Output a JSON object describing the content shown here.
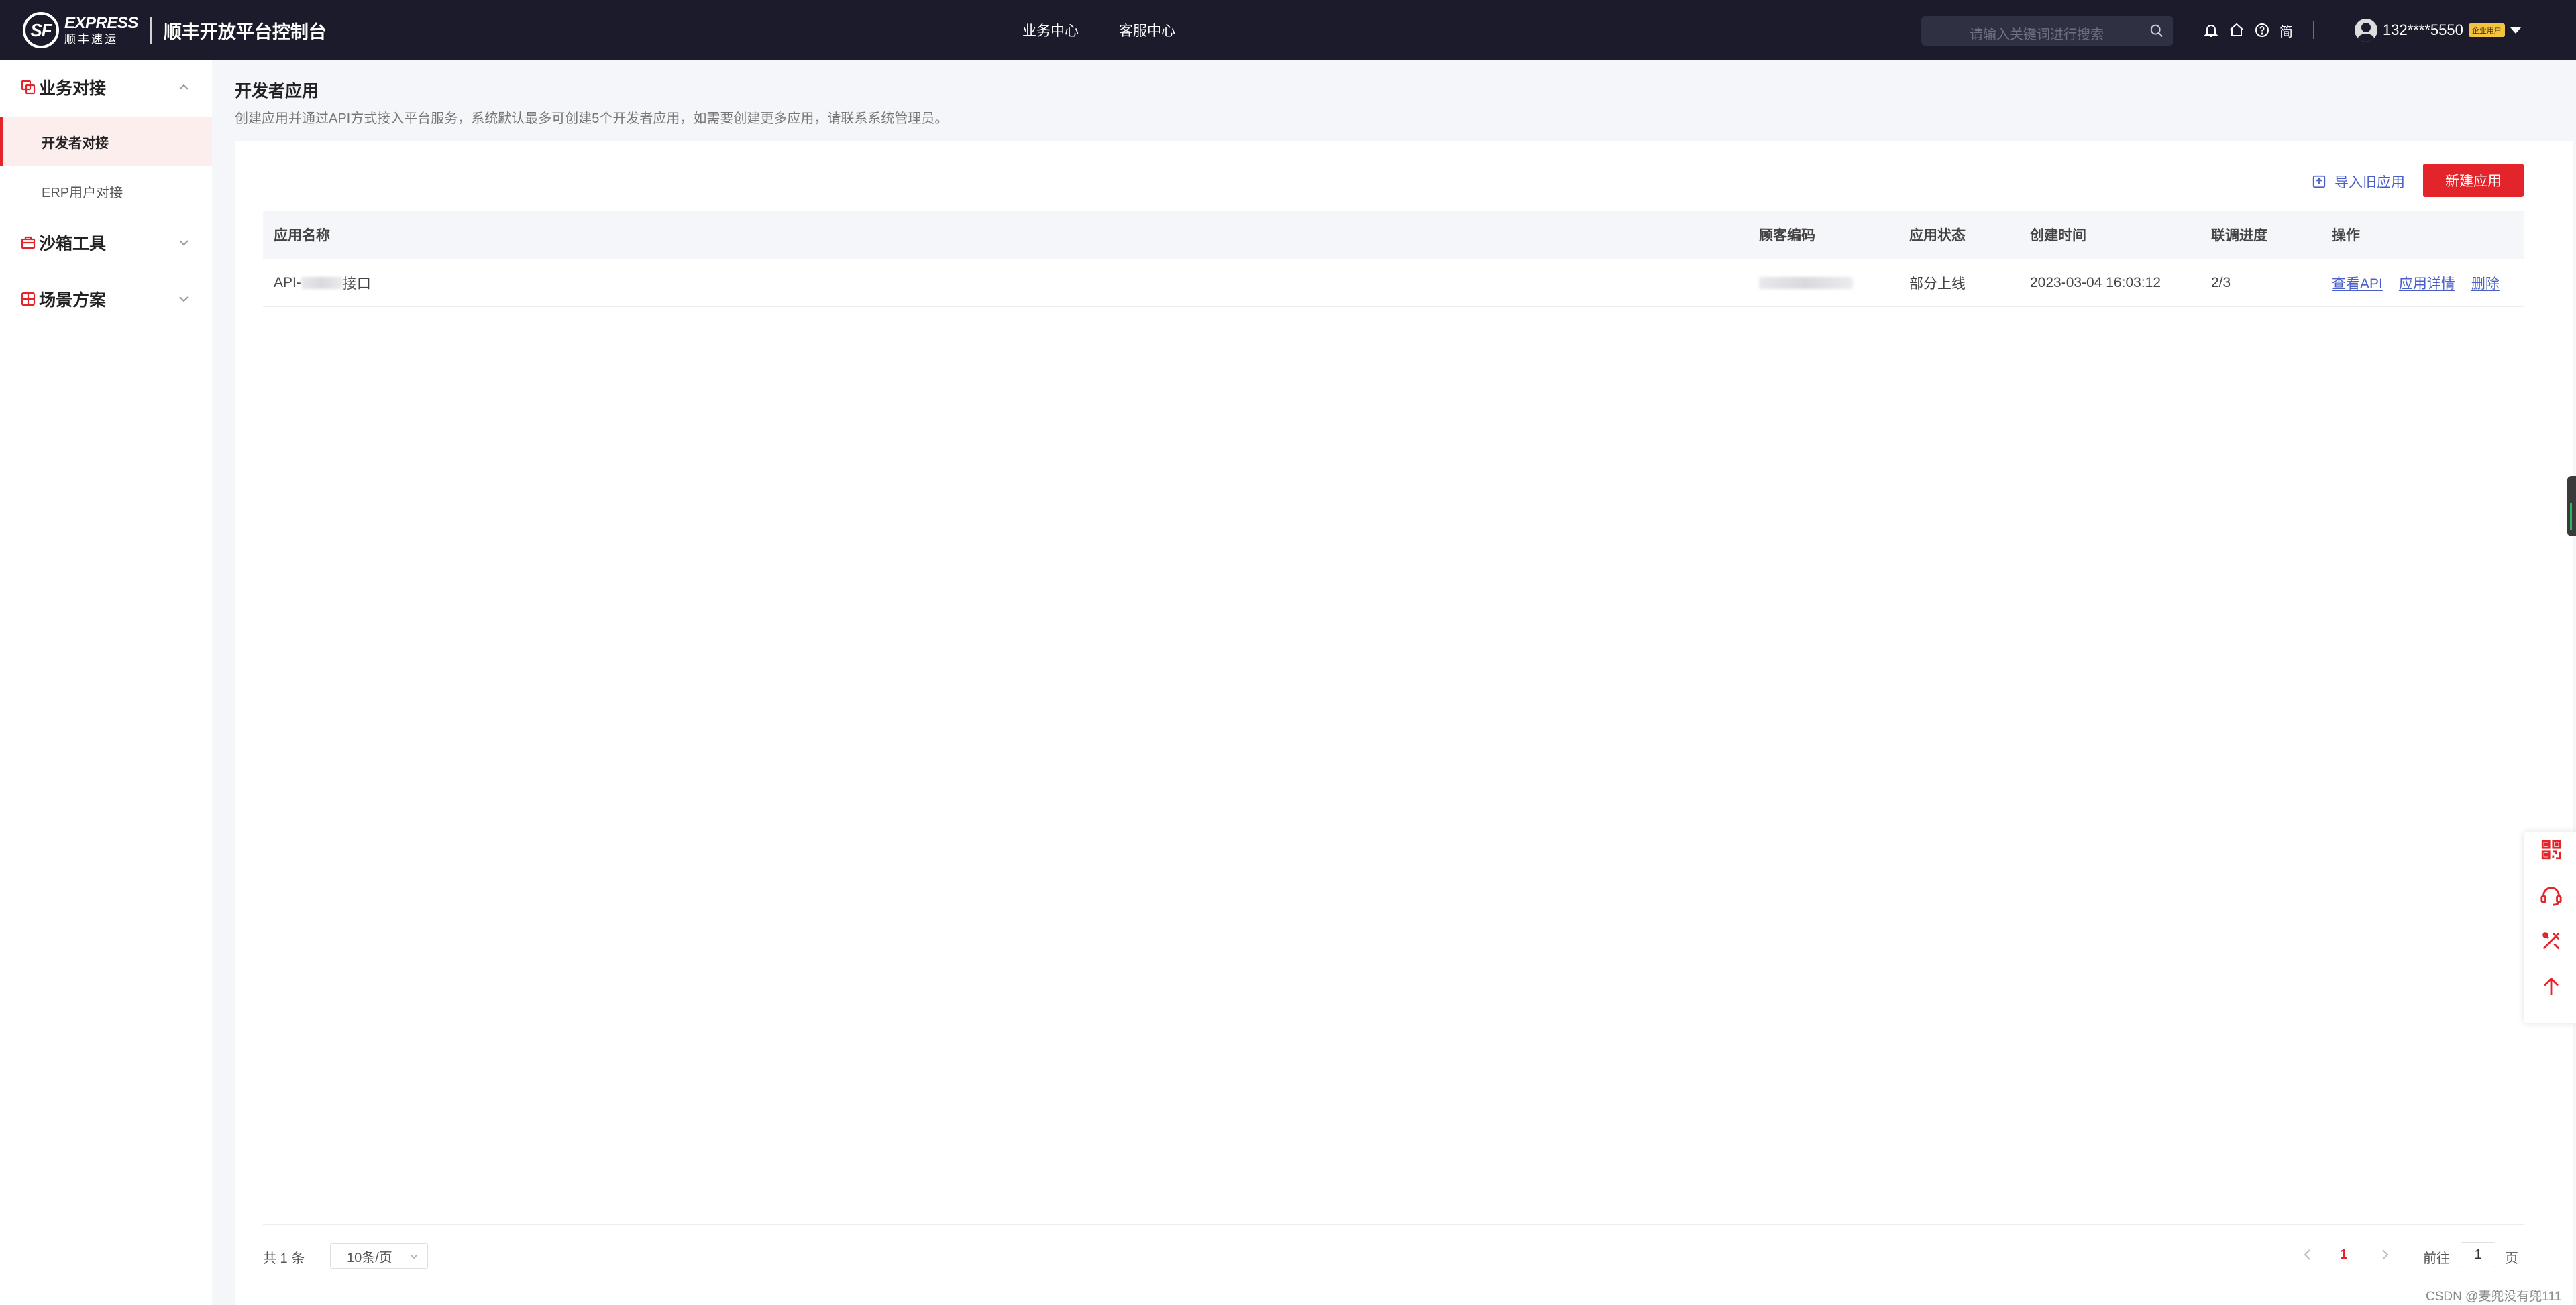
{
  "header": {
    "logo_en": "EXPRESS",
    "logo_cn": "顺丰速运",
    "logo_mark": "SF",
    "app_title": "顺丰开放平台控制台",
    "nav": [
      "业务中心",
      "客服中心"
    ],
    "search_placeholder": "请输入关键词进行搜索",
    "lang": "简",
    "user_name": "132****5550",
    "user_badge": "企业用户"
  },
  "sidebar": {
    "groups": [
      {
        "label": "业务对接",
        "expanded": true
      },
      {
        "label": "沙箱工具",
        "expanded": false
      },
      {
        "label": "场景方案",
        "expanded": false
      }
    ],
    "items": [
      {
        "label": "开发者对接",
        "active": true
      },
      {
        "label": "ERP用户对接",
        "active": false
      }
    ]
  },
  "main": {
    "title": "开发者应用",
    "description": "创建应用并通过API方式接入平台服务，系统默认最多可创建5个开发者应用，如需要创建更多应用，请联系系统管理员。",
    "import_label": "导入旧应用",
    "new_label": "新建应用",
    "table": {
      "headers": [
        "应用名称",
        "顾客编码",
        "应用状态",
        "创建时间",
        "联调进度",
        "操作"
      ],
      "rows": [
        {
          "name_prefix": "API-",
          "name_suffix": "接口",
          "status": "部分上线",
          "created": "2023-03-04 16:03:12",
          "progress": "2/3",
          "actions": [
            "查看API",
            "应用详情",
            "删除"
          ]
        }
      ]
    },
    "pagination": {
      "total": "共 1 条",
      "page_size": "10条/页",
      "current_page": "1",
      "goto_label": "前往",
      "goto_value": "1",
      "page_suffix": "页"
    }
  },
  "watermark": "CSDN @麦兜没有兜111",
  "floating_tools": [
    "qr-code-icon",
    "headset-icon",
    "tools-icon",
    "back-to-top-icon"
  ],
  "colors": {
    "brand_red": "#e3242b",
    "topbar_bg": "#1b1b2b",
    "link_blue": "#4a5fc8"
  }
}
